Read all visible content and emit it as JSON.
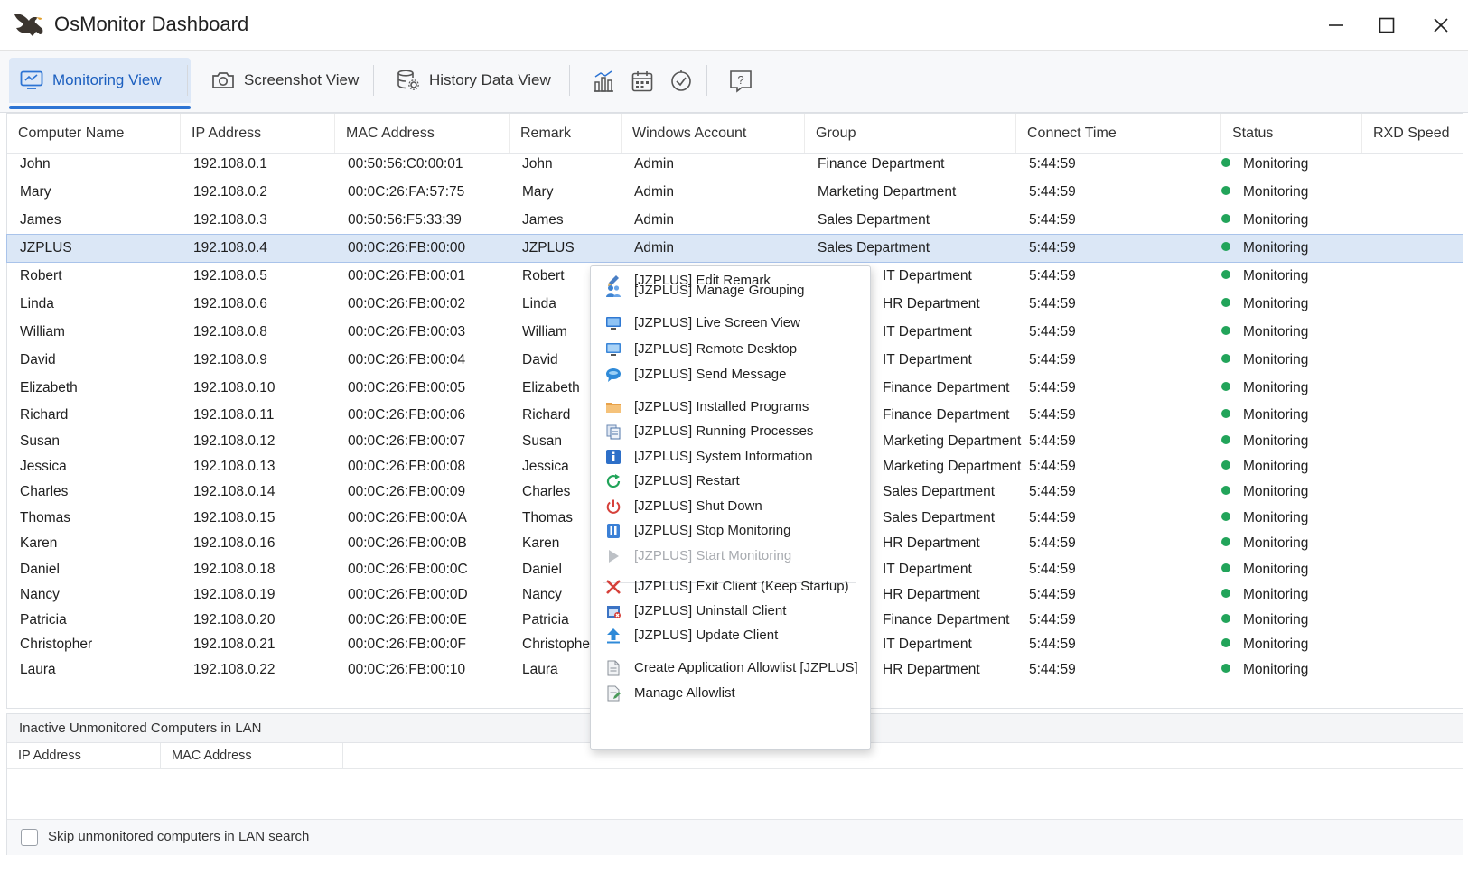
{
  "window": {
    "title": "OsMonitor Dashboard",
    "icon": "eagle-app-icon",
    "controls": [
      "minimize-icon",
      "maximize-icon",
      "close-icon"
    ]
  },
  "toolbar": {
    "tabs": [
      {
        "label": "Monitoring View",
        "icon": "monitor-icon",
        "active": true
      },
      {
        "label": "Screenshot View",
        "icon": "camera-icon",
        "active": false
      },
      {
        "label": "History Data View",
        "icon": "database-gear-icon",
        "active": false
      }
    ],
    "tools": [
      "chart-icon",
      "calendar-icon",
      "clock-check-icon",
      "help-icon"
    ],
    "tool_help_text": "?"
  },
  "table": {
    "columns": [
      "Computer Name",
      "IP Address",
      "MAC Address",
      "Remark",
      "Windows Account",
      "Group",
      "Connect Time",
      "Status",
      "RXD Speed"
    ],
    "selected_index": 3,
    "rows": [
      {
        "name": "John",
        "ip": "192.108.0.1",
        "mac": "00:50:56:C0:00:01",
        "remark": "John",
        "account": "Admin",
        "group": "Finance Department",
        "time": "5:44:59",
        "status": "Monitoring"
      },
      {
        "name": "Mary",
        "ip": "192.108.0.2",
        "mac": "00:0C:26:FA:57:75",
        "remark": "Mary",
        "account": "Admin",
        "group": "Marketing Department",
        "time": "5:44:59",
        "status": "Monitoring"
      },
      {
        "name": "James",
        "ip": "192.108.0.3",
        "mac": "00:50:56:F5:33:39",
        "remark": "James",
        "account": "Admin",
        "group": "Sales Department",
        "time": "5:44:59",
        "status": "Monitoring"
      },
      {
        "name": "JZPLUS",
        "ip": "192.108.0.4",
        "mac": "00:0C:26:FB:00:00",
        "remark": "JZPLUS",
        "account": "Admin",
        "group": "Sales Department",
        "time": "5:44:59",
        "status": "Monitoring"
      },
      {
        "name": "Robert",
        "ip": "192.108.0.5",
        "mac": "00:0C:26:FB:00:01",
        "remark": "Robert",
        "account": "",
        "group": "IT Department",
        "time": "5:44:59",
        "status": "Monitoring"
      },
      {
        "name": "Linda",
        "ip": "192.108.0.6",
        "mac": "00:0C:26:FB:00:02",
        "remark": "Linda",
        "account": "",
        "group": "HR Department",
        "time": "5:44:59",
        "status": "Monitoring"
      },
      {
        "name": "William",
        "ip": "192.108.0.8",
        "mac": "00:0C:26:FB:00:03",
        "remark": "William",
        "account": "",
        "group": "IT Department",
        "time": "5:44:59",
        "status": "Monitoring"
      },
      {
        "name": "David",
        "ip": "192.108.0.9",
        "mac": "00:0C:26:FB:00:04",
        "remark": "David",
        "account": "",
        "group": "IT Department",
        "time": "5:44:59",
        "status": "Monitoring"
      },
      {
        "name": "Elizabeth",
        "ip": "192.108.0.10",
        "mac": "00:0C:26:FB:00:05",
        "remark": "Elizabeth",
        "account": "",
        "group": "Finance Department",
        "time": "5:44:59",
        "status": "Monitoring"
      },
      {
        "name": "Richard",
        "ip": "192.108.0.11",
        "mac": "00:0C:26:FB:00:06",
        "remark": "Richard",
        "account": "",
        "group": "Finance Department",
        "time": "5:44:59",
        "status": "Monitoring"
      },
      {
        "name": "Susan",
        "ip": "192.108.0.12",
        "mac": "00:0C:26:FB:00:07",
        "remark": "Susan",
        "account": "",
        "group": "Marketing Department",
        "time": "5:44:59",
        "status": "Monitoring"
      },
      {
        "name": "Jessica",
        "ip": "192.108.0.13",
        "mac": "00:0C:26:FB:00:08",
        "remark": "Jessica",
        "account": "",
        "group": "Marketing Department",
        "time": "5:44:59",
        "status": "Monitoring"
      },
      {
        "name": "Charles",
        "ip": "192.108.0.14",
        "mac": "00:0C:26:FB:00:09",
        "remark": "Charles",
        "account": "",
        "group": "Sales Department",
        "time": "5:44:59",
        "status": "Monitoring"
      },
      {
        "name": "Thomas",
        "ip": "192.108.0.15",
        "mac": "00:0C:26:FB:00:0A",
        "remark": "Thomas",
        "account": "",
        "group": "Sales Department",
        "time": "5:44:59",
        "status": "Monitoring"
      },
      {
        "name": "Karen",
        "ip": "192.108.0.16",
        "mac": "00:0C:26:FB:00:0B",
        "remark": "Karen",
        "account": "",
        "group": "HR Department",
        "time": "5:44:59",
        "status": "Monitoring"
      },
      {
        "name": "Daniel",
        "ip": "192.108.0.18",
        "mac": "00:0C:26:FB:00:0C",
        "remark": "Daniel",
        "account": "",
        "group": "IT Department",
        "time": "5:44:59",
        "status": "Monitoring"
      },
      {
        "name": "Nancy",
        "ip": "192.108.0.19",
        "mac": "00:0C:26:FB:00:0D",
        "remark": "Nancy",
        "account": "",
        "group": "HR Department",
        "time": "5:44:59",
        "status": "Monitoring"
      },
      {
        "name": "Patricia",
        "ip": "192.108.0.20",
        "mac": "00:0C:26:FB:00:0E",
        "remark": "Patricia",
        "account": "",
        "group": "Finance Department",
        "time": "5:44:59",
        "status": "Monitoring"
      },
      {
        "name": "Christopher",
        "ip": "192.108.0.21",
        "mac": "00:0C:26:FB:00:0F",
        "remark": "Christopher",
        "account": "",
        "group": "IT Department",
        "time": "5:44:59",
        "status": "Monitoring"
      },
      {
        "name": "Laura",
        "ip": "192.108.0.22",
        "mac": "00:0C:26:FB:00:10",
        "remark": "Laura",
        "account": "",
        "group": "HR Department",
        "time": "5:44:59",
        "status": "Monitoring"
      }
    ]
  },
  "context_menu": {
    "items": [
      {
        "label": "[JZPLUS] Edit Remark",
        "icon": "pencil-icon",
        "enabled": true
      },
      {
        "label": "[JZPLUS] Manage Grouping",
        "icon": "users-icon",
        "enabled": true
      },
      {
        "separator": true
      },
      {
        "label": "[JZPLUS] Live Screen View",
        "icon": "screen-icon",
        "enabled": true
      },
      {
        "label": "[JZPLUS] Remote Desktop",
        "icon": "remote-desktop-icon",
        "enabled": true
      },
      {
        "label": "[JZPLUS] Send Message",
        "icon": "chat-bubble-icon",
        "enabled": true
      },
      {
        "separator": true
      },
      {
        "label": "[JZPLUS] Installed Programs",
        "icon": "folder-icon",
        "enabled": true
      },
      {
        "label": "[JZPLUS] Running Processes",
        "icon": "processes-icon",
        "enabled": true
      },
      {
        "label": "[JZPLUS] System Information",
        "icon": "info-icon",
        "enabled": true
      },
      {
        "label": "[JZPLUS] Restart",
        "icon": "restart-icon",
        "enabled": true
      },
      {
        "label": "[JZPLUS] Shut Down",
        "icon": "power-icon",
        "enabled": true
      },
      {
        "label": "[JZPLUS] Stop Monitoring",
        "icon": "pause-icon",
        "enabled": true
      },
      {
        "label": "[JZPLUS] Start Monitoring",
        "icon": "play-icon",
        "enabled": false
      },
      {
        "separator": true
      },
      {
        "label": "[JZPLUS] Exit Client (Keep Startup)",
        "icon": "red-x-icon",
        "enabled": true
      },
      {
        "label": "[JZPLUS] Uninstall Client",
        "icon": "uninstall-icon",
        "enabled": true
      },
      {
        "label": "[JZPLUS] Update Client",
        "icon": "upload-arrow-icon",
        "enabled": true
      },
      {
        "separator": true
      },
      {
        "label": "Create Application Allowlist [JZPLUS]",
        "icon": "document-icon",
        "enabled": true
      },
      {
        "label": "Manage Allowlist",
        "icon": "document-edit-icon",
        "enabled": true
      }
    ]
  },
  "lan_panel": {
    "title": "Inactive Unmonitored Computers in LAN",
    "columns": [
      "IP Address",
      "MAC Address"
    ],
    "skip_label": "Skip unmonitored computers in LAN search",
    "skip_checked": false
  },
  "colors": {
    "accent": "#2d74d4",
    "selected_row": "#dbe7f6",
    "status_ok": "#22a45a",
    "menu_disabled": "#a8abb0"
  }
}
